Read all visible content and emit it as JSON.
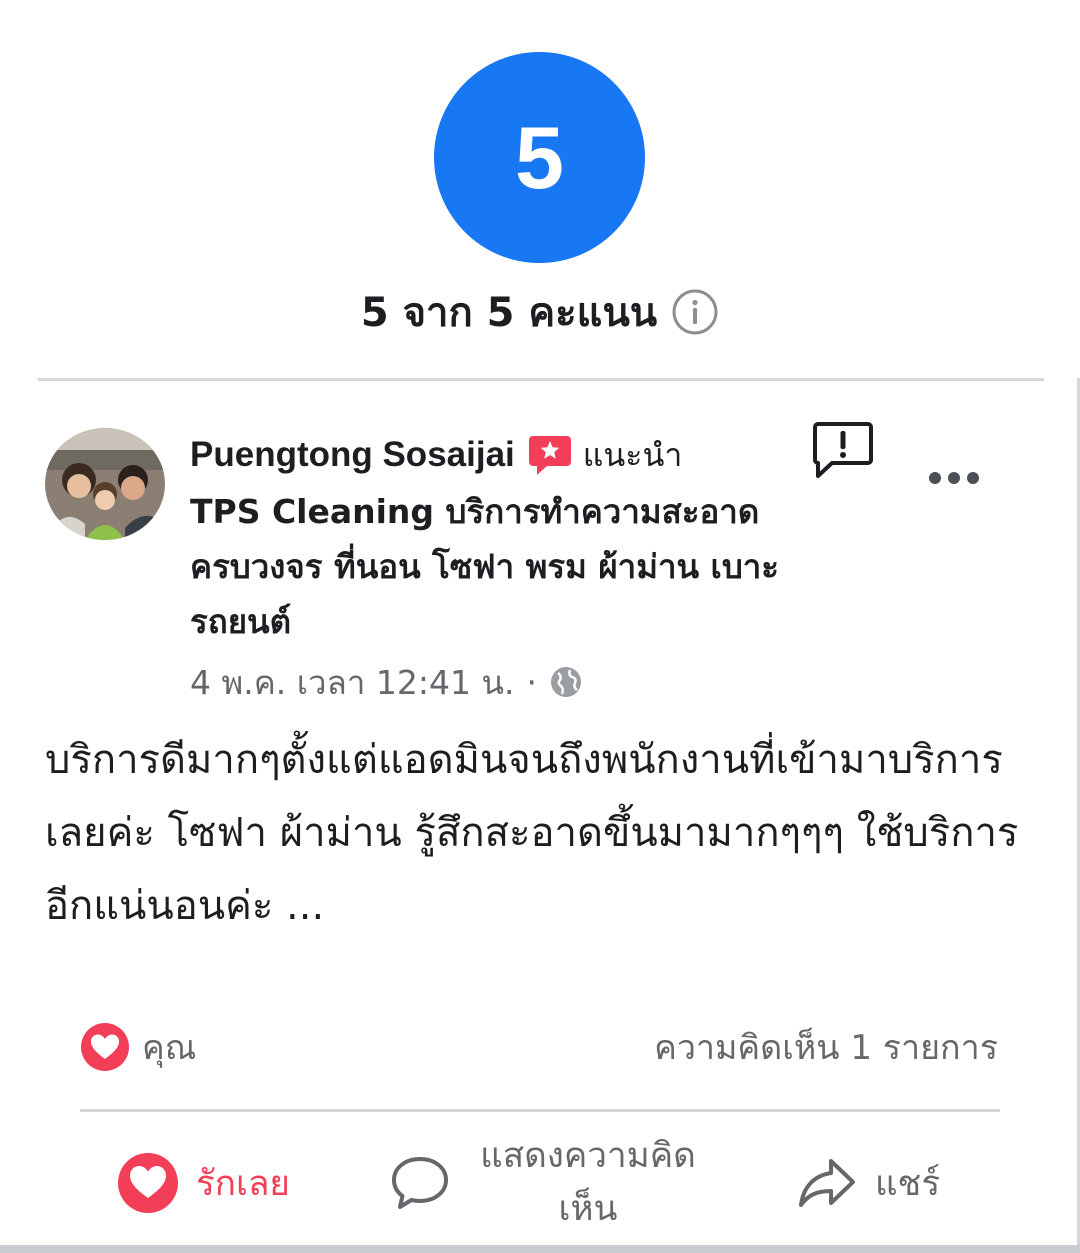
{
  "rating": {
    "score": "5",
    "summary": "5 จาก 5 คะแนน"
  },
  "review": {
    "author": "Puengtong Sosaijai",
    "recommend_label": "แนะนำ",
    "page_name": "TPS Cleaning บริการทำความสะอาด ครบวงจร ที่นอน โซฟา พรม ผ้าม่าน เบาะรถยนต์",
    "date": "4 พ.ค. เวลา 12:41 น.",
    "separator": "·",
    "audience_icon": "globe-icon",
    "text": "บริการดีมากๆตั้งแต่แอดมินจนถึงพนักงานที่เข้ามาบริการเลยค่ะ โซฟา ผ้าม่าน รู้สึกสะอาดขึ้นมามากๆๆๆ ใช้บริการอีกแน่นอนค่ะ ..."
  },
  "reactions": {
    "reactor_label": "คุณ",
    "comment_count_label": "ความคิดเห็น 1 รายการ"
  },
  "actions": {
    "love_label": "รักเลย",
    "comment_label": "แสดงความคิดเห็น",
    "share_label": "แชร์"
  },
  "colors": {
    "accent_blue": "#1877f2",
    "love_red": "#f33e58",
    "secondary_text": "#65676b"
  }
}
